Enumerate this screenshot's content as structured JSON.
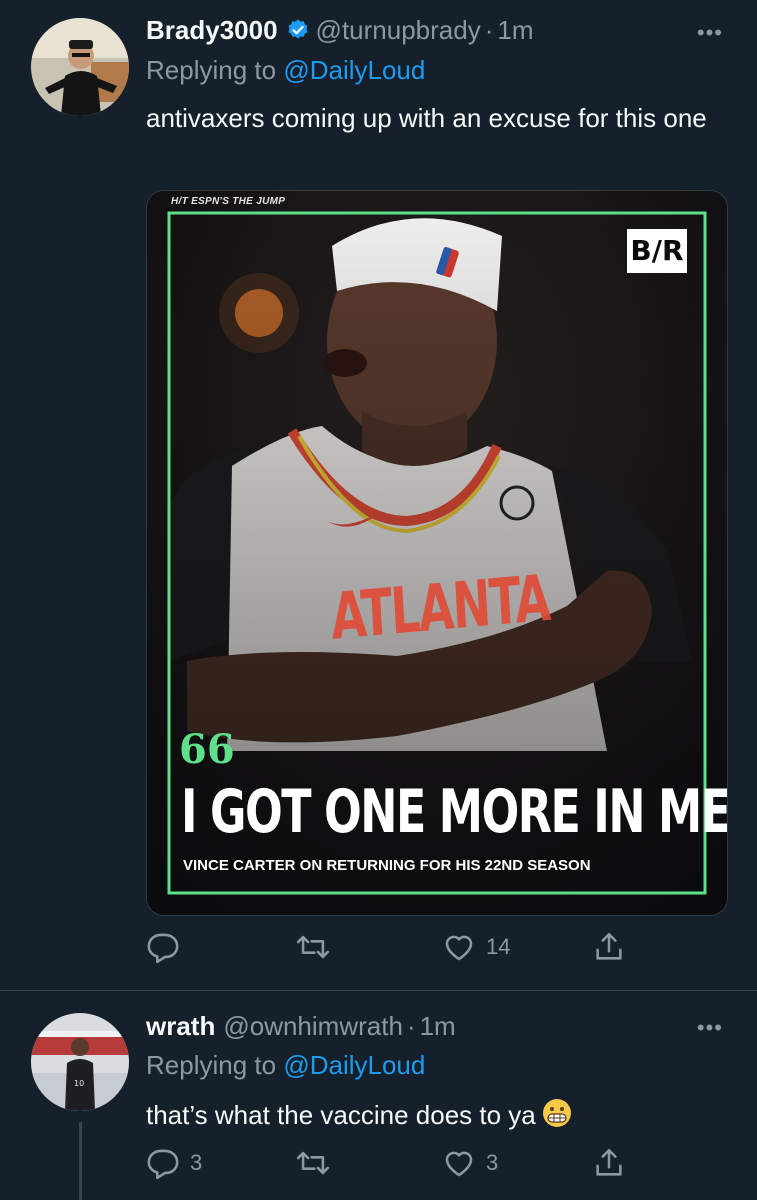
{
  "tweets": [
    {
      "name": "Brady3000",
      "handle": "@turnupbrady",
      "separator": "·",
      "time": "1m",
      "verified": true,
      "replying_prefix": "Replying to",
      "replying_to": "@DailyLoud",
      "text": "antivaxers coming up with an excuse for this one",
      "more_label": "•••",
      "actions": {
        "reply_count": "",
        "retweet_count": "",
        "like_count": "14"
      },
      "media": {
        "credit": "H/T ESPN'S THE JUMP",
        "logo": "B/R",
        "quote_mark": "66",
        "headline": "I GOT ONE MORE IN ME.",
        "caption": "VINCE CARTER ON RETURNING FOR HIS 22ND SEASON",
        "jersey_text": "ATLANTA",
        "border_color": "#5ee08a"
      }
    },
    {
      "name": "wrath",
      "handle": "@ownhimwrath",
      "separator": "·",
      "time": "1m",
      "verified": false,
      "replying_prefix": "Replying to",
      "replying_to": "@DailyLoud",
      "text": "that’s what the vaccine does to ya",
      "emoji": "grimacing-face",
      "more_label": "•••",
      "actions": {
        "reply_count": "3",
        "retweet_count": "",
        "like_count": "3"
      }
    }
  ],
  "colors": {
    "background": "#15202b",
    "secondary_text": "#8b98a5",
    "accent": "#1d9bf0",
    "divider": "#38444d"
  }
}
